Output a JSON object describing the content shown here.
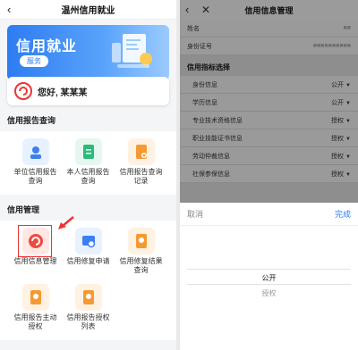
{
  "left": {
    "nav": {
      "back_icon": "‹",
      "title": "温州信用就业"
    },
    "banner": {
      "title": "信用就业",
      "badge": "服务"
    },
    "greeting": "您好, 某某某",
    "report_section": {
      "title": "信用报告查询",
      "items": [
        {
          "label": "单位信用报告查询",
          "icon": "building-person-icon"
        },
        {
          "label": "本人信用报告查询",
          "icon": "document-icon"
        },
        {
          "label": "信用报告查询记录",
          "icon": "record-icon"
        }
      ]
    },
    "manage_section": {
      "title": "信用管理",
      "items": [
        {
          "label": "信用信息管理",
          "icon": "refresh-circle-icon"
        },
        {
          "label": "信用修复申请",
          "icon": "search-card-icon"
        },
        {
          "label": "信用修复结果查询",
          "icon": "certificate-icon"
        },
        {
          "label": "信用报告主动授权",
          "icon": "certificate-icon"
        },
        {
          "label": "信用报告授权列表",
          "icon": "certificate-icon"
        }
      ]
    }
  },
  "right": {
    "nav": {
      "back_icon": "‹",
      "close_icon": "✕",
      "title": "信用信息管理"
    },
    "fields": [
      {
        "label": "姓名",
        "value": "■■"
      },
      {
        "label": "身份证号",
        "value": "■■■■■■■■■■"
      }
    ],
    "section_title": "信用指标选择",
    "indicators": [
      {
        "label": "身份信息",
        "value": "公开"
      },
      {
        "label": "学历信息",
        "value": "公开"
      },
      {
        "label": "专业技术资格信息",
        "value": "授权"
      },
      {
        "label": "职业技能证书信息",
        "value": "授权"
      },
      {
        "label": "劳动仲裁信息",
        "value": "授权"
      },
      {
        "label": "社保参保信息",
        "value": "授权"
      }
    ],
    "picker": {
      "cancel": "取消",
      "done": "完成",
      "options": [
        "公开",
        "授权"
      ],
      "selected": "公开"
    }
  }
}
